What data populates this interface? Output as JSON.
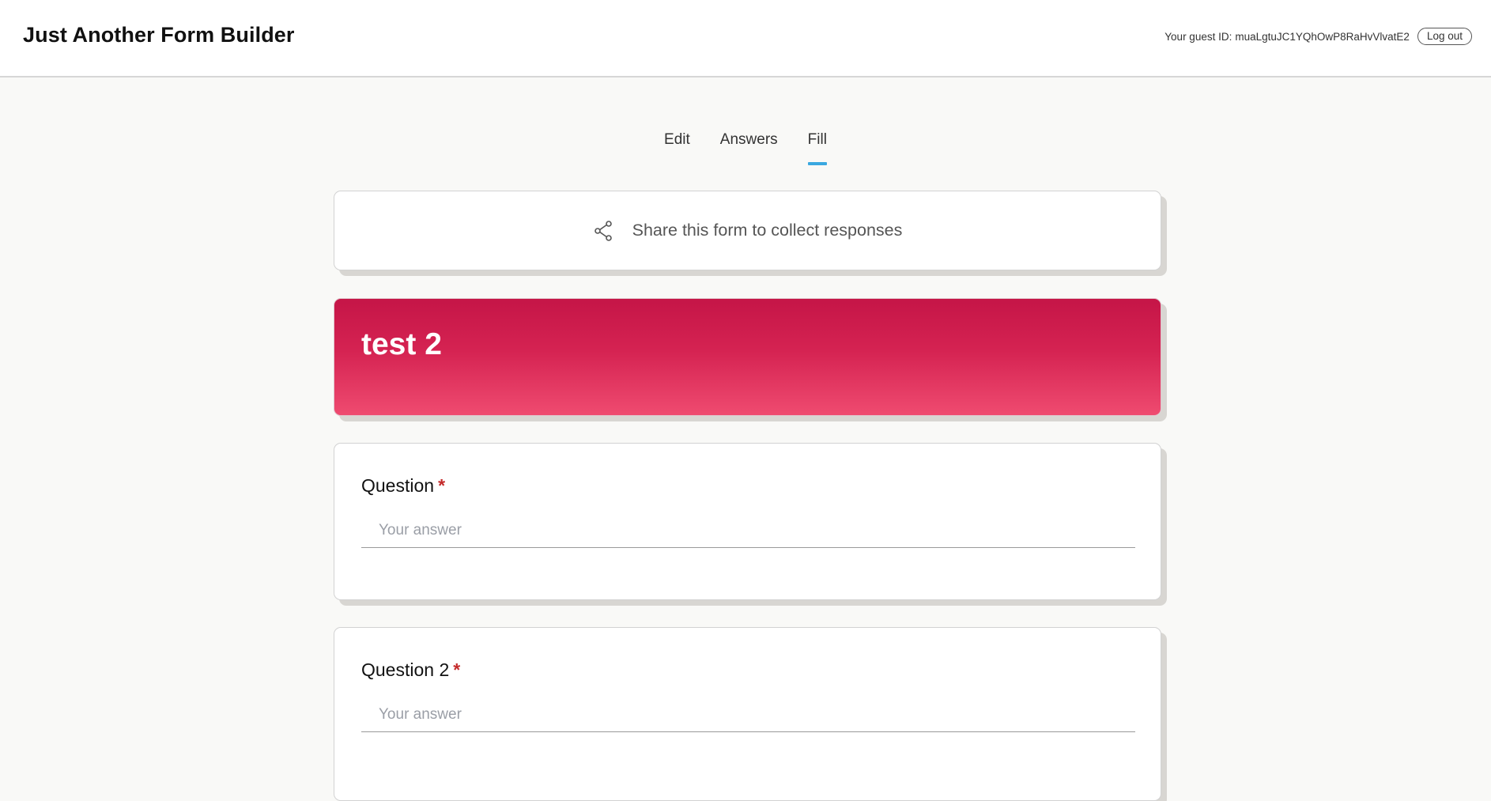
{
  "header": {
    "brand": "Just Another Form Builder",
    "guest_label": "Your guest ID:",
    "guest_id": "muaLgtuJC1YQhOwP8RaHvVlvatE2",
    "logout_label": "Log out"
  },
  "tabs": [
    {
      "label": "Edit",
      "active": false
    },
    {
      "label": "Answers",
      "active": false
    },
    {
      "label": "Fill",
      "active": true
    }
  ],
  "share": {
    "icon": "share-icon",
    "text": "Share this form to collect responses"
  },
  "form": {
    "title": "test 2",
    "title_gradient": [
      "#c51547",
      "#ef4b70"
    ],
    "accent_color": "#3aa8e0",
    "questions": [
      {
        "label": "Question",
        "required_mark": "*",
        "placeholder": "Your answer"
      },
      {
        "label": "Question 2",
        "required_mark": "*",
        "placeholder": "Your answer"
      }
    ]
  }
}
